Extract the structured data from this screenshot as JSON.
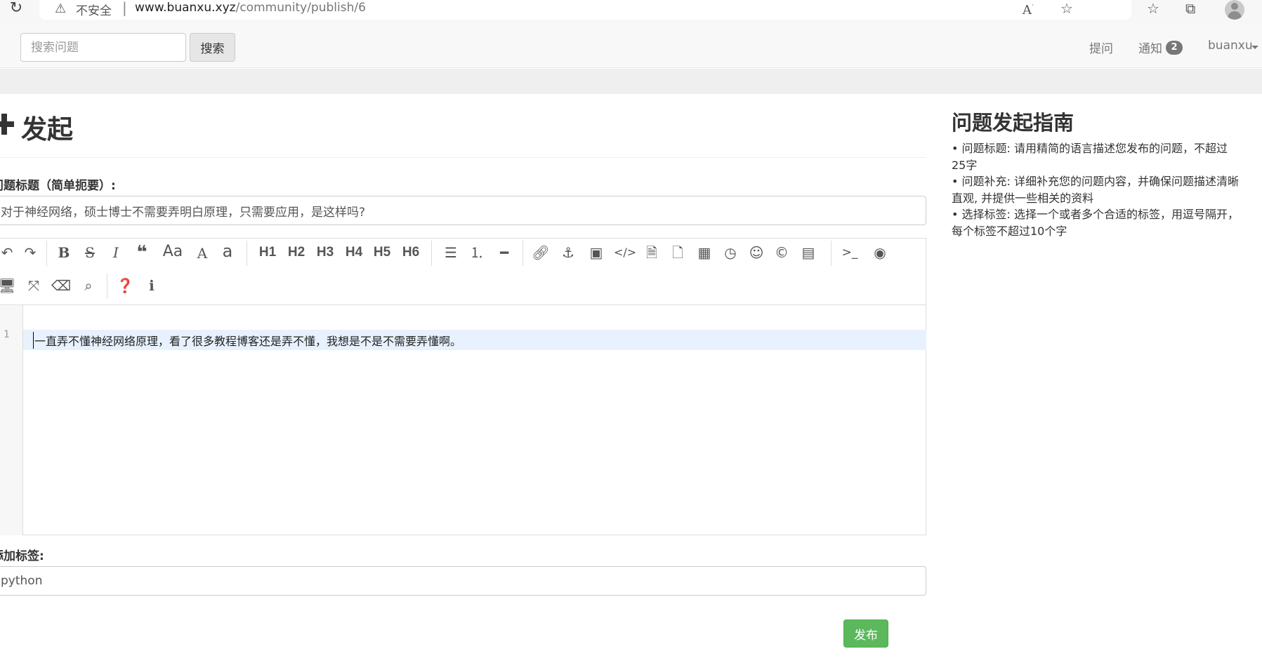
{
  "browser": {
    "insecure_label": "不安全",
    "url_domain": "www.buanxu.xyz",
    "url_path": "/community/publish/6"
  },
  "navbar": {
    "search_placeholder": "搜索问题",
    "search_button": "搜索",
    "ask": "提问",
    "notifications": "通知",
    "notification_count": "2",
    "user": "buanxu"
  },
  "page": {
    "title": "发起",
    "title_label": "问题标题（简单扼要）:",
    "title_value": "对于神经网络，硕士博士不需要弄明白原理，只需要应用，是这样吗?",
    "editor": {
      "toolbar_headings": [
        "H1",
        "H2",
        "H3",
        "H4",
        "H5",
        "H6"
      ],
      "line_number": "1",
      "content": "一直弄不懂神经网络原理，看了很多教程博客还是弄不懂，我想是不是不需要弄懂啊。"
    },
    "tags_label": "添加标签:",
    "tags_value": "python",
    "publish_button": "发布"
  },
  "guide": {
    "title": "问题发起指南",
    "items": [
      "问题标题: 请用精简的语言描述您发布的问题，不超过25字",
      "问题补充: 详细补充您的问题内容，并确保问题描述清晰直观, 并提供一些相关的资料",
      "选择标签: 选择一个或者多个合适的标签，用逗号隔开，每个标签不超过10个字"
    ]
  }
}
